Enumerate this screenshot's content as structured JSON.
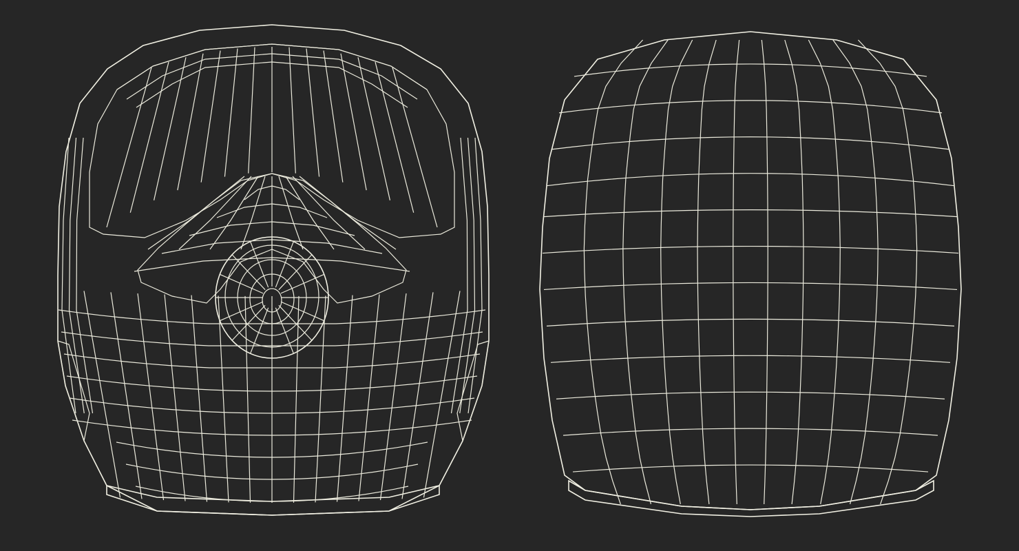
{
  "scene": {
    "background": "#262626",
    "surface": "#7d7d70",
    "surface_dark": "#5c5c52",
    "surface_light": "#8c8c7f",
    "wire": "#ecebdd",
    "views": [
      {
        "id": "front",
        "subject": "mask-wireframe-front"
      },
      {
        "id": "back",
        "subject": "mask-wireframe-back"
      }
    ]
  }
}
